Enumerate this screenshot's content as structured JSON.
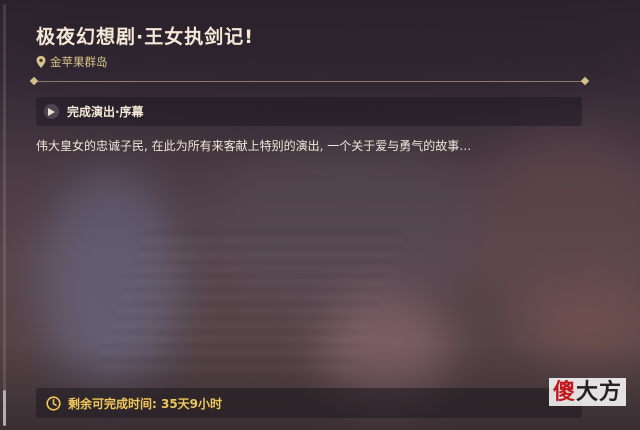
{
  "event": {
    "title": "极夜幻想剧·王女执剑记!",
    "location": "金苹果群岛",
    "quest_label": "完成演出·序幕",
    "description": "伟大皇女的忠诚子民, 在此为所有来客献上特别的演出, 一个关于爱与勇气的故事…",
    "timer_text": "剩余可完成时间: 35天9小时"
  },
  "icons": {
    "location": "map-pin-icon",
    "quest": "play-icon",
    "timer": "clock-icon"
  },
  "colors": {
    "title": "#f3e9d6",
    "location": "#d9c48a",
    "timer": "#f0c75a",
    "watermark_red": "#c0181c"
  },
  "watermark": {
    "part1": "傻",
    "part2": "大方"
  }
}
